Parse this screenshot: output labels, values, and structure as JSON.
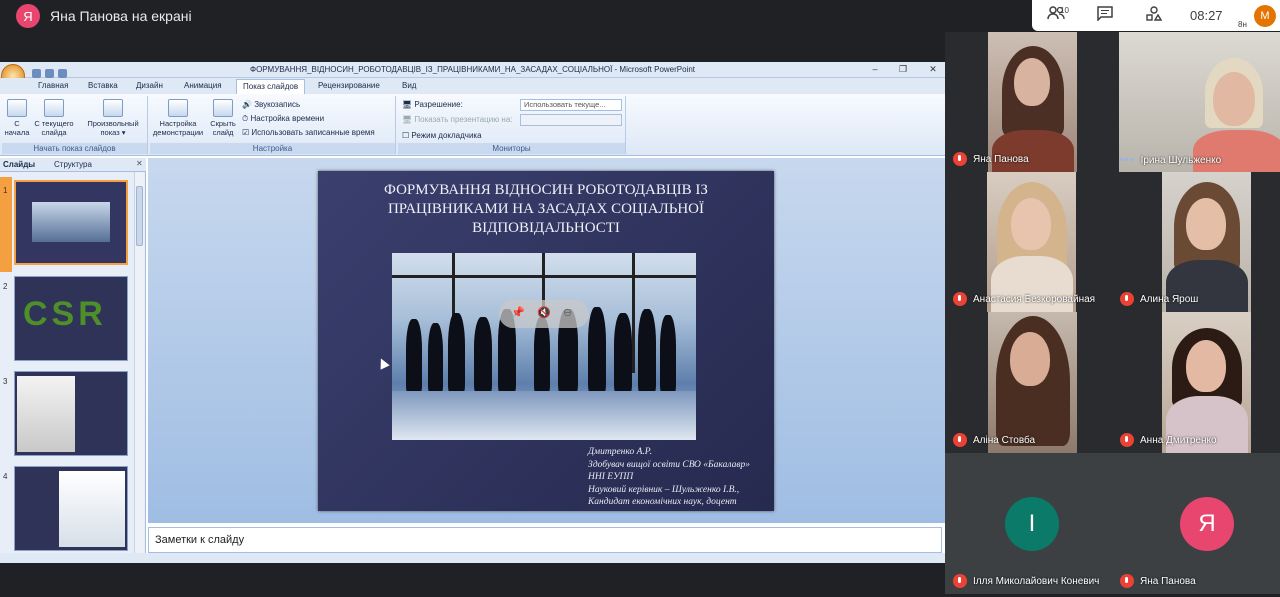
{
  "meet": {
    "presenter_avatar_letter": "Я",
    "presenter_text": "Яна Панова на екрані",
    "participants_count": "10",
    "time": "08:27",
    "small_label": "8н",
    "self_avatar_letter": "M",
    "accent_color": "#e8466e"
  },
  "powerpoint": {
    "window_title": "ФОРМУВАННЯ_ВІДНОСИН_РОБОТОДАВЦІВ_ІЗ_ПРАЦІВНИКАМИ_НА_ЗАСАДАХ_СОЦІАЛЬНОЇ - Microsoft PowerPoint",
    "tabs": [
      "Главная",
      "Вставка",
      "Дизайн",
      "Анимация",
      "Показ слайдов",
      "Рецензирование",
      "Вид"
    ],
    "active_tab": "Показ слайдов",
    "ribbon": {
      "btn_from_start": "С начала",
      "btn_from_current": "С текущего слайда",
      "btn_custom_show": "Произвольный показ ▾",
      "group_start": "Начать показ слайдов",
      "btn_setup": "Настройка демонстрации",
      "btn_hide": "Скрыть слайд",
      "opt_sound": "Звукозапись",
      "opt_timing": "Настройка времени",
      "opt_use_timings": "Использовать записанные время",
      "group_setup": "Настройка",
      "resolution_label": "Разрешение:",
      "resolution_value": "Использовать текуще...",
      "show_on_label": "Показать презентацию на:",
      "presenter_mode": "Режим докладчика",
      "group_monitors": "Мониторы"
    },
    "pane_tabs": [
      "Слайды",
      "Структура"
    ],
    "slide_numbers": [
      "1",
      "2",
      "3",
      "4"
    ],
    "thumb_csr_text": "CSR",
    "slide": {
      "title": "ФОРМУВАННЯ ВІДНОСИН РОБОТОДАВЦІВ ІЗ ПРАЦІВНИКАМИ НА ЗАСАДАХ СОЦІАЛЬНОЇ ВІДПОВІДАЛЬНОСТІ",
      "author_lines": [
        "Дмитренко А.Р.",
        "Здобувач вищої освіти СВО «Бакалавр»",
        "ННІ ЕУПП",
        "Науковий керівник – Шульженко І.В.,",
        "Кандидат економічних наук, доцент"
      ]
    },
    "notes_placeholder": "Заметки к слайду"
  },
  "participants": [
    {
      "name": "Яна Панова",
      "muted": true
    },
    {
      "name": "Ірина Шульженко",
      "muted": false
    },
    {
      "name": "Анастасия Безкоровайная",
      "muted": true
    },
    {
      "name": "Алина Ярош",
      "muted": true
    },
    {
      "name": "Аліна Стовба",
      "muted": true
    },
    {
      "name": "Анна Дмитренко",
      "muted": true
    },
    {
      "name": "Ілля Миколайович Коневич",
      "muted": true,
      "avatar_letter": "І",
      "avatar_color": "#0b7a68"
    },
    {
      "name": "Яна Панова",
      "muted": true,
      "avatar_letter": "Я",
      "avatar_color": "#e8466e"
    }
  ]
}
